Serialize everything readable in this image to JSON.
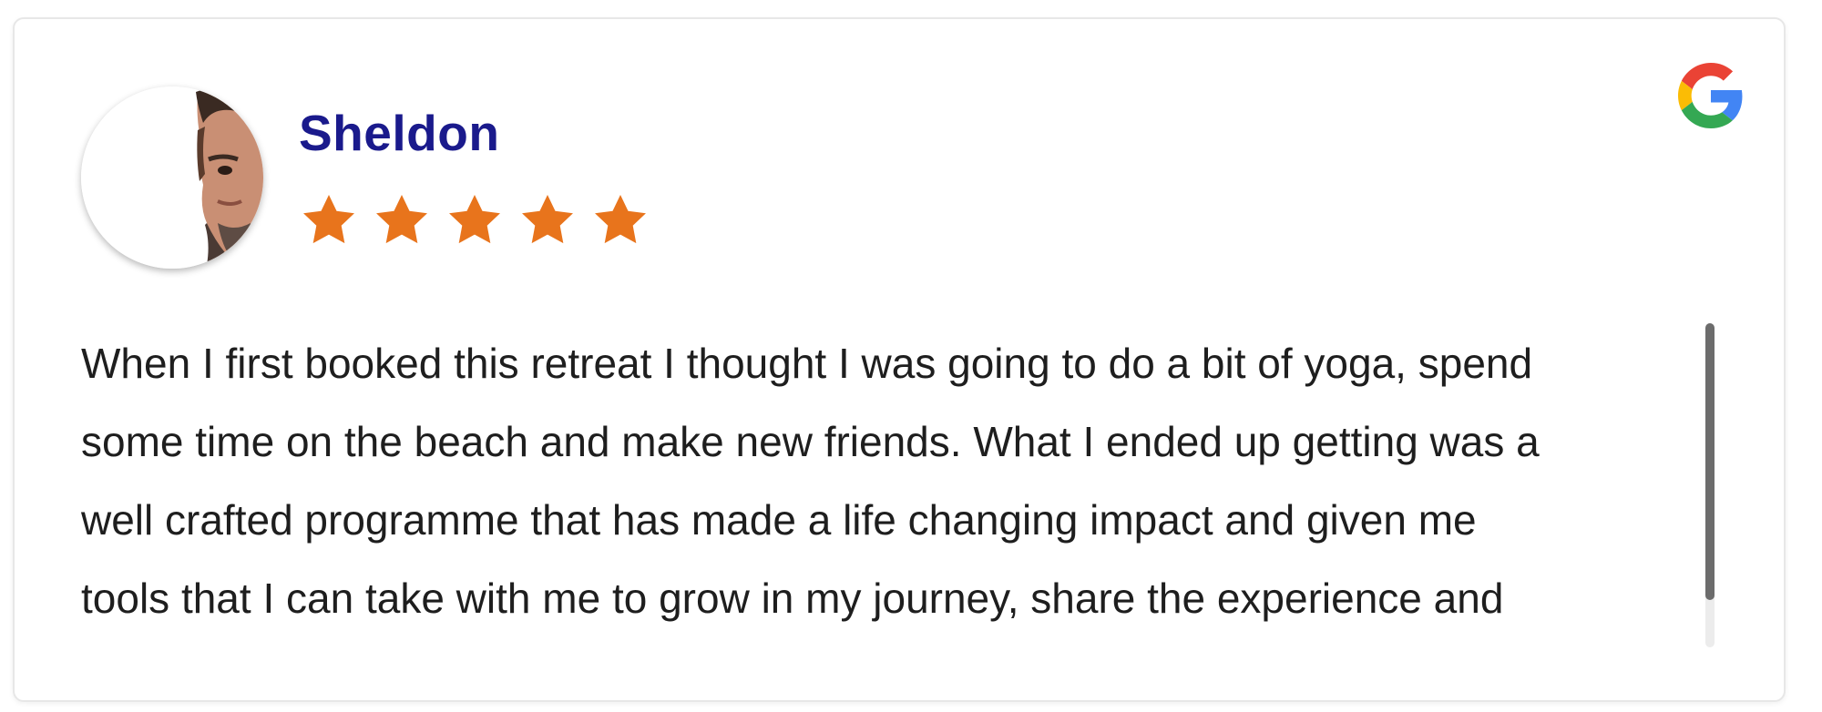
{
  "review": {
    "reviewer_name": "Sheldon",
    "rating": 5,
    "max_rating": 5,
    "text": "When I first booked this retreat I thought I was going to do a bit of yoga, spend\nsome time on the beach and make new friends. What I ended up getting was a\nwell crafted programme that has made a life changing impact and given me\ntools that I can take with me to grow in my journey, share the experience and",
    "scroll_position": 0
  },
  "icons": {
    "avatar": "reviewer-photo",
    "source": "google-g-icon",
    "star": "star-icon"
  },
  "colors": {
    "name": "#1a1a8c",
    "star": "#e8741c",
    "text": "#1e1e1e",
    "google_blue": "#4285F4",
    "google_red": "#EA4335",
    "google_yellow": "#FBBC05",
    "google_green": "#34A853"
  }
}
